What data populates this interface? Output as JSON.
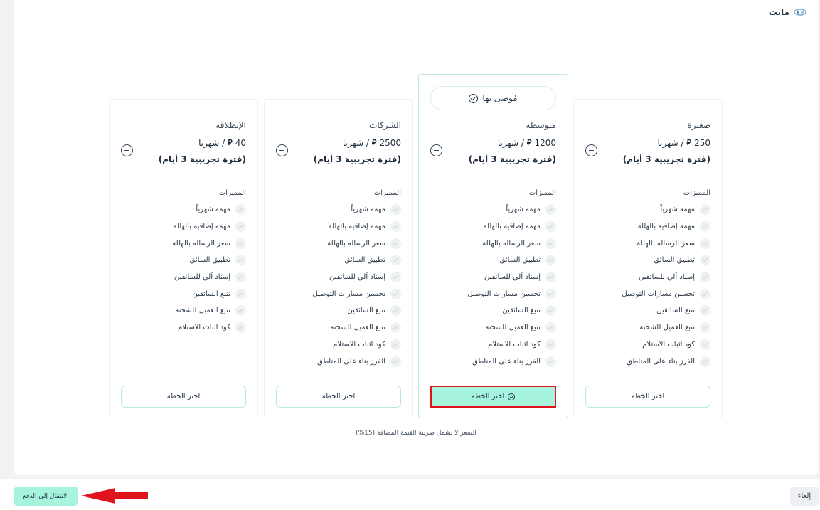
{
  "brand": {
    "name": "مابت"
  },
  "recommended_label": "مُوصى بها",
  "features_title": "المميزات",
  "choose_label": "اختر الخطة",
  "trial_label": "(فترة تجريبية 3 أيام)",
  "price_suffix": "/ شهريا",
  "currency_symbol": "⃁",
  "plans": [
    {
      "name": "صغيرة",
      "price": "250",
      "features": [
        "مهمة شهرياً",
        "مهمة إضافيه بالهلله",
        "سعر الرساله بالهللة",
        "تطبيق السائق",
        "إسناد آلي للسائقين",
        "تحسين مسارات التوصيل",
        "تتبع السائقين",
        "تتبع العميل للشحنة",
        "كود اثبات الاستلام",
        "الفرز بناء على المناطق"
      ]
    },
    {
      "name": "متوسطة",
      "price": "1200",
      "recommended": true,
      "selected": true,
      "features": [
        "مهمة شهرياً",
        "مهمة إضافيه بالهلله",
        "سعر الرساله بالهللة",
        "تطبيق السائق",
        "إسناد آلي للسائقين",
        "تحسين مسارات التوصيل",
        "تتبع السائقين",
        "تتبع العميل للشحنة",
        "كود اثبات الاستلام",
        "الفرز بناء على المناطق"
      ]
    },
    {
      "name": "الشركات",
      "price": "2500",
      "features": [
        "مهمة شهرياً",
        "مهمة إضافيه بالهلله",
        "سعر الرساله بالهللة",
        "تطبيق السائق",
        "إسناد آلي للسائقين",
        "تحسين مسارات التوصيل",
        "تتبع السائقين",
        "تتبع العميل للشحنة",
        "كود اثبات الاستلام",
        "الفرز بناء على المناطق"
      ]
    },
    {
      "name": "الإنطلاقة",
      "price": "40",
      "features": [
        "مهمة شهرياً",
        "مهمة إضافيه بالهلله",
        "سعر الرساله بالهللة",
        "تطبيق السائق",
        "إسناد آلي للسائقين",
        "تتبع السائقين",
        "تتبع العميل للشحنة",
        "كود اثبات الاستلام"
      ]
    }
  ],
  "vat_note": "السعر لا يشمل ضريبة القيمة المضافة (15%)",
  "footer": {
    "cancel_label": "إلغاء",
    "pay_label": "الانتقال إلى الدفع"
  },
  "colors": {
    "accent": "#a6f3de",
    "highlight_border": "#e0141c",
    "text_dark": "#24364a"
  }
}
